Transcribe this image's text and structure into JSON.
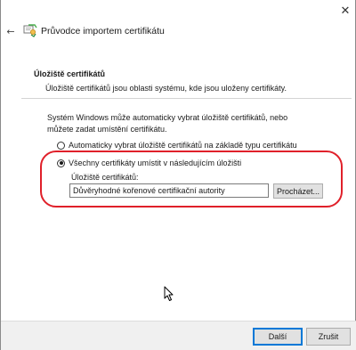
{
  "window": {
    "title": "Průvodce importem certifikátu",
    "close_glyph": "✕",
    "back_glyph": "←"
  },
  "section": {
    "title": "Úložiště certifikátů",
    "description": "Úložiště certifikátů jsou oblasti systému, kde jsou uloženy certifikáty."
  },
  "body": {
    "paragraph": "Systém Windows může automaticky vybrat úložiště certifikátů, nebo můžete zadat umístění certifikátu.",
    "radio_auto_label": "Automaticky vybrat úložiště certifikátů na základě typu certifikátu",
    "radio_auto_checked": false,
    "radio_manual_label": "Všechny certifikáty umístit v následujícím úložišti",
    "radio_manual_checked": true,
    "store_label": "Úložiště certifikátů:",
    "store_value": "Důvěryhodné kořenové certifikační autority",
    "browse_label": "Procházet..."
  },
  "footer": {
    "next_label": "Další",
    "cancel_label": "Zrušit"
  },
  "colors": {
    "highlight": "#e0202a",
    "primary_border": "#0078d7"
  },
  "icons": {
    "wizard": "certificate-wizard-icon",
    "cursor": "mouse-cursor-icon"
  }
}
